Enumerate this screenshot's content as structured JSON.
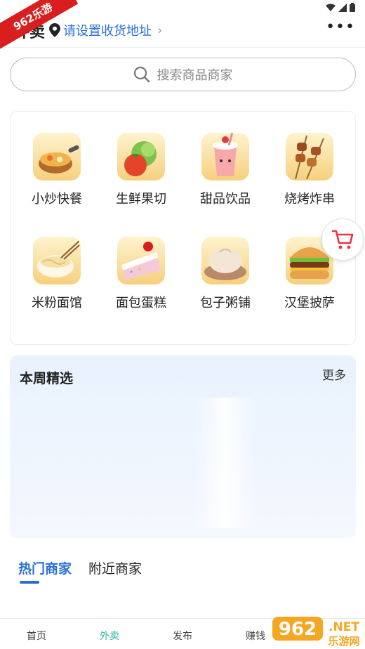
{
  "watermark": {
    "text": "962乐游"
  },
  "status_bar": {
    "icons": [
      "wifi-icon",
      "signal-icon",
      "battery-icon"
    ]
  },
  "header": {
    "title": "外卖",
    "location_label": "请设置收货地址",
    "more_label": "•••"
  },
  "search": {
    "placeholder": "搜索商品商家"
  },
  "categories": [
    {
      "label": "小炒快餐",
      "icon": "stir-fry-icon"
    },
    {
      "label": "生鲜果切",
      "icon": "fresh-fruit-icon"
    },
    {
      "label": "甜品饮品",
      "icon": "drinks-icon"
    },
    {
      "label": "烧烤炸串",
      "icon": "bbq-icon"
    },
    {
      "label": "米粉面馆",
      "icon": "noodles-icon"
    },
    {
      "label": "面包蛋糕",
      "icon": "cake-icon"
    },
    {
      "label": "包子粥铺",
      "icon": "bun-icon"
    },
    {
      "label": "汉堡披萨",
      "icon": "burger-icon"
    }
  ],
  "weekly": {
    "title": "本周精选",
    "more_label": "更多"
  },
  "merchant_tabs": [
    {
      "label": "热门商家",
      "active": true
    },
    {
      "label": "附近商家",
      "active": false
    }
  ],
  "bottom_nav": [
    {
      "label": "首页",
      "active": false
    },
    {
      "label": "外卖",
      "active": true
    },
    {
      "label": "发布",
      "active": false
    },
    {
      "label": "赚钱",
      "active": false
    }
  ],
  "logo": {
    "text": "962.NET",
    "subtext": "乐游网"
  },
  "colors": {
    "accent_blue": "#2b6fd6",
    "nav_active": "#2fb6a5",
    "cart_red": "#e8334a",
    "watermark_red": "#d81e1e"
  }
}
